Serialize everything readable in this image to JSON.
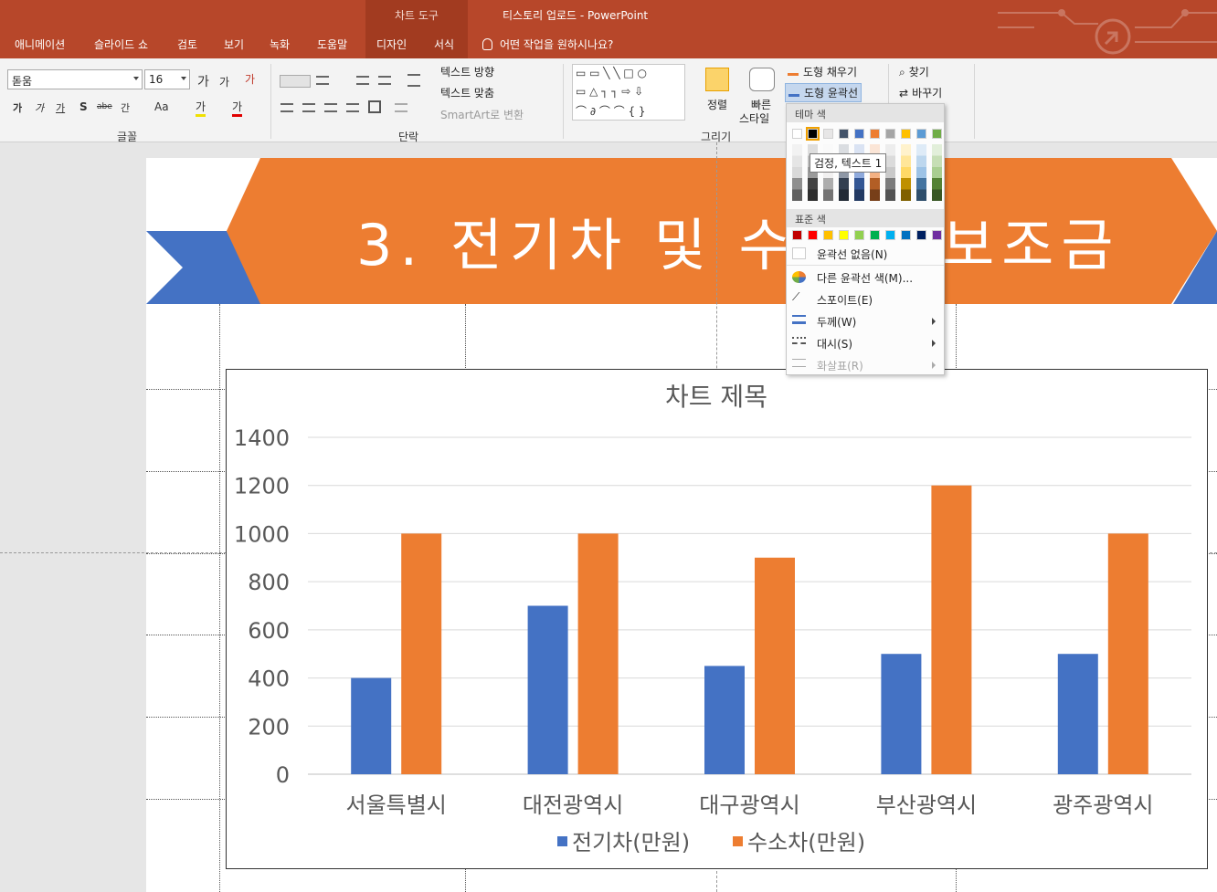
{
  "window": {
    "context_tab_group": "차트 도구",
    "title": "티스토리 업로드  -  PowerPoint",
    "tabs": [
      "애니메이션",
      "슬라이드 쇼",
      "검토",
      "보기",
      "녹화",
      "도움말",
      "디자인",
      "서식"
    ],
    "tell_me": "어떤 작업을 원하시나요?"
  },
  "ribbon": {
    "font": {
      "name": "돋움",
      "size": "16",
      "group_label": "글꼴",
      "grow": "가",
      "shrink": "가",
      "clear": "가",
      "bold": "가",
      "italic": "가",
      "underline": "가",
      "shadow": "S",
      "strike": "abe",
      "spacing": "간",
      "case": "Aa",
      "color_a": "가",
      "color_b": "가"
    },
    "paragraph": {
      "group_label": "단락",
      "text_direction": "텍스트 방향",
      "align_text": "텍스트 맞춤",
      "smartart": "SmartArt로 변환"
    },
    "drawing": {
      "group_label": "그리기",
      "arrange": "정렬",
      "quick_styles_line1": "빠른",
      "quick_styles_line2": "스타일",
      "shape_fill": "도형 채우기",
      "shape_outline": "도형 윤곽선"
    },
    "editing": {
      "find": "찾기",
      "replace": "바꾸기"
    }
  },
  "slide": {
    "title": "3. 전기차 및 수소차 보조금"
  },
  "outline_menu": {
    "theme_colors_label": "테마 색",
    "standard_colors_label": "표준 색",
    "tooltip": "검정, 텍스트 1",
    "items": [
      {
        "label": "윤곽선 없음(N)",
        "enabled": true,
        "submenu": false
      },
      {
        "label": "다른 윤곽선 색(M)...",
        "enabled": true,
        "submenu": false
      },
      {
        "label": "스포이트(E)",
        "enabled": true,
        "submenu": false
      },
      {
        "label": "두께(W)",
        "enabled": true,
        "submenu": true
      },
      {
        "label": "대시(S)",
        "enabled": true,
        "submenu": true
      },
      {
        "label": "화살표(R)",
        "enabled": false,
        "submenu": true
      }
    ],
    "theme_top_row": [
      "#ffffff",
      "#000000",
      "#e7e6e6",
      "#44546a",
      "#4472c4",
      "#ed7d31",
      "#a5a5a5",
      "#ffc000",
      "#5b9bd5",
      "#70ad47"
    ],
    "standard_row": [
      "#c00000",
      "#ff0000",
      "#ffc000",
      "#ffff00",
      "#92d050",
      "#00b050",
      "#00b0f0",
      "#0070c0",
      "#002060",
      "#7030a0"
    ]
  },
  "colors": {
    "title_bar": "#b7472a",
    "banner_orange": "#ed7d31",
    "banner_blue": "#4472c4",
    "series_blue": "#4472c4",
    "series_orange": "#ed7d31"
  },
  "chart_data": {
    "type": "bar",
    "title": "차트 제목",
    "categories": [
      "서울특별시",
      "대전광역시",
      "대구광역시",
      "부산광역시",
      "광주광역시"
    ],
    "series": [
      {
        "name": "전기차(만원)",
        "values": [
          400,
          700,
          450,
          500,
          500
        ],
        "color": "#4472c4"
      },
      {
        "name": "수소차(만원)",
        "values": [
          1000,
          1000,
          900,
          1200,
          1000
        ],
        "color": "#ed7d31"
      }
    ],
    "yticks": [
      "0",
      "200",
      "400",
      "600",
      "800",
      "1000",
      "1200",
      "1400"
    ],
    "ylim": [
      0,
      1400
    ],
    "grid": true,
    "legend": "bottom",
    "xlabel": "",
    "ylabel": ""
  }
}
